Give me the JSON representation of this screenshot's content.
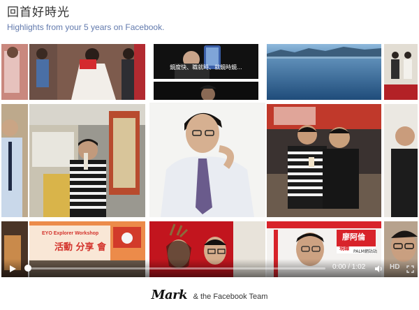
{
  "header": {
    "title": "回首好時光",
    "subtitle": "Highlights from your 5 years on Facebook."
  },
  "video": {
    "caption_text": "鏡度快、職就時、就鏡時鏡...",
    "time_label": "0:00 / 1:02",
    "hd_label": "HD",
    "progress_fraction": 0.0
  },
  "tiles": {
    "store_banner": "EYO Explorer Workshop",
    "store_banner_2": "活動 分享 會",
    "tv_label": "廖阿倫",
    "tv_sub": "現職",
    "tv_side": "PALM網站站"
  },
  "footer": {
    "signature": "Mark",
    "text": "& the Facebook Team"
  },
  "colors": {
    "link_blue": "#627aad",
    "accent_red": "#d8232a"
  }
}
